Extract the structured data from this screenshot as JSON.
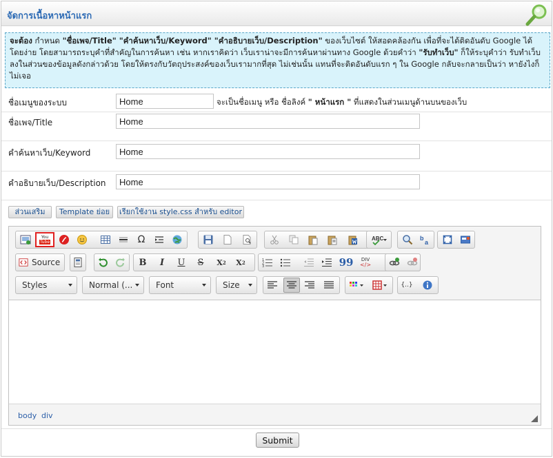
{
  "header": {
    "title": "จัดการเนื้อหาหน้าแรก",
    "icon": "search-magnifier-icon"
  },
  "notice": {
    "t1": "จะต้อง",
    "t2": " กำหนด ",
    "t3": "\"ชื่อเพจ/Title\" \"คำค้นหาเว็บ/Keyword\" \"คำอธิบายเว็บ/Description\"",
    "t4": " ของเว็บไซต์ ให้สอดคล้องกัน เพื่อที่จะได้ติดอันดับ Google ได้โดยง่าย โดยสามารถระบุคำที่สำคัญในการค้นหา เช่น หากเราคิดว่า เว็บเราน่าจะมีการค้นหาผ่านทาง Google ด้วยคำว่า ",
    "t5": "\"รับทำเว็บ\"",
    "t6": " ก็ให้ระบุคำว่า รับทำเว็บ ลงในส่วนของข้อมูลดังกล่าวด้วย โดยให้ตรงกับวัตถุประสงค์ของเว็บเรามากที่สุด ไม่เช่นนั้น แทนที่จะติดอันดับแรก ๆ ใน Google กลับจะกลายเป็นว่า หายังไงก็ไม่เจอ"
  },
  "form": {
    "menu_name": {
      "label": "ชื่อเมนูของระบบ",
      "value": "Home",
      "hint1": "จะเป็นชื่อเมนู หรือ ชื่อลิงค์ ",
      "hint2": "\" หน้าแรก \"",
      "hint3": " ที่แสดงในส่วนเมนูด้านบนของเว็บ"
    },
    "title": {
      "label": "ชื่อเพจ/Title",
      "value": "Home"
    },
    "keyword": {
      "label": "คำค้นหาเว็บ/Keyword",
      "value": "Home"
    },
    "description": {
      "label": "คำอธิบายเว็บ/Description",
      "value": "Home"
    }
  },
  "tabs": [
    "ส่วนเสริม",
    "Template ย่อย",
    "เรียกใช้งาน style.css สำหรับ editor"
  ],
  "editor": {
    "source_label": "Source",
    "combos": {
      "styles": "Styles",
      "format": "Normal (...",
      "font": "Font",
      "size": "Size"
    },
    "bold": "B",
    "italic": "I",
    "underline": "U",
    "strike": "S",
    "subscript": "X",
    "superscript": "X",
    "sub_mark": "2",
    "sup_mark": "2",
    "omega": "Ω",
    "quote": "99",
    "div": "DIV",
    "code": "{..}",
    "youtube_a": "You",
    "youtube_b": "Tube",
    "path": [
      "body",
      "div"
    ]
  },
  "submit_label": "Submit",
  "colors": {
    "title_blue": "#2d6bb5",
    "notice_bg": "#d9f3fb",
    "notice_border": "#5aa6c8",
    "youtube_highlight": "#e02020"
  }
}
